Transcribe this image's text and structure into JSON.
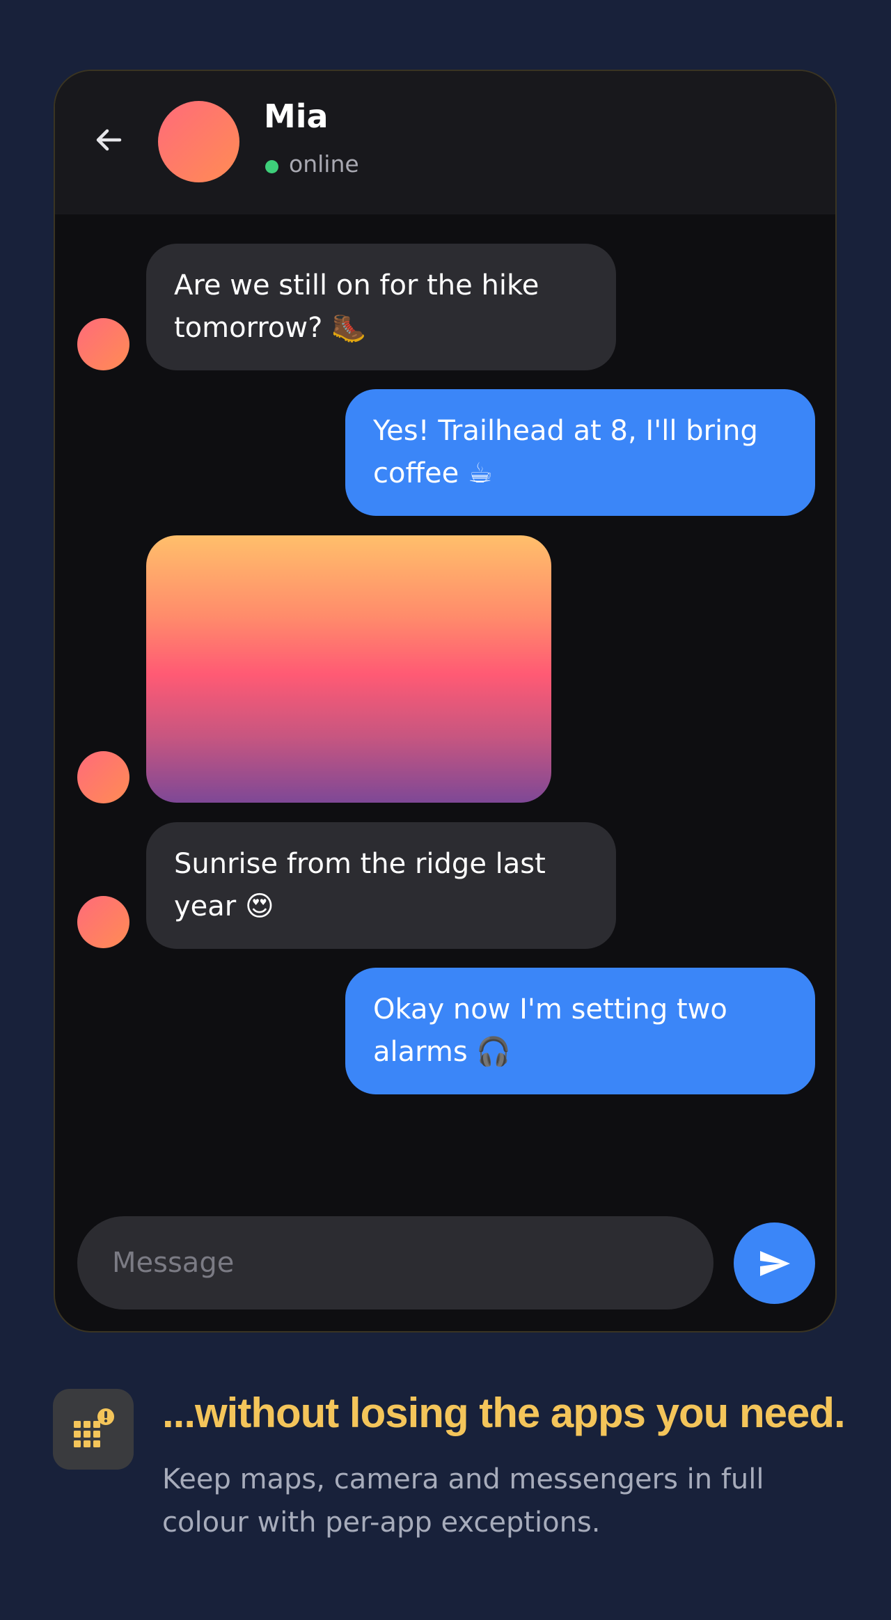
{
  "chat": {
    "contact_name": "Mia",
    "status": "online",
    "messages": [
      {
        "direction": "incoming",
        "text": "Are we still on for the hike tomorrow? 🥾"
      },
      {
        "direction": "outgoing",
        "text": "Yes! Trailhead at 8, I'll bring coffee ☕"
      },
      {
        "direction": "incoming",
        "type": "image",
        "text": ""
      },
      {
        "direction": "incoming",
        "text": "Sunrise from the ridge last year 😍"
      },
      {
        "direction": "outgoing",
        "text": "Okay now I'm setting two alarms 🎧"
      }
    ],
    "input_placeholder": "Message"
  },
  "feature": {
    "title": "...without losing the apps you need.",
    "subtitle": "Keep maps, camera and messengers in full colour with per-app exceptions."
  },
  "icons": {
    "back": "arrow-left-icon",
    "send": "send-icon",
    "feature": "app-grid-alert-icon"
  },
  "colors": {
    "background": "#18213a",
    "incoming_bubble": "#2c2c31",
    "outgoing_bubble": "#3b86f8",
    "online_dot": "#3ecf7a",
    "accent_title": "#f4c55a"
  }
}
